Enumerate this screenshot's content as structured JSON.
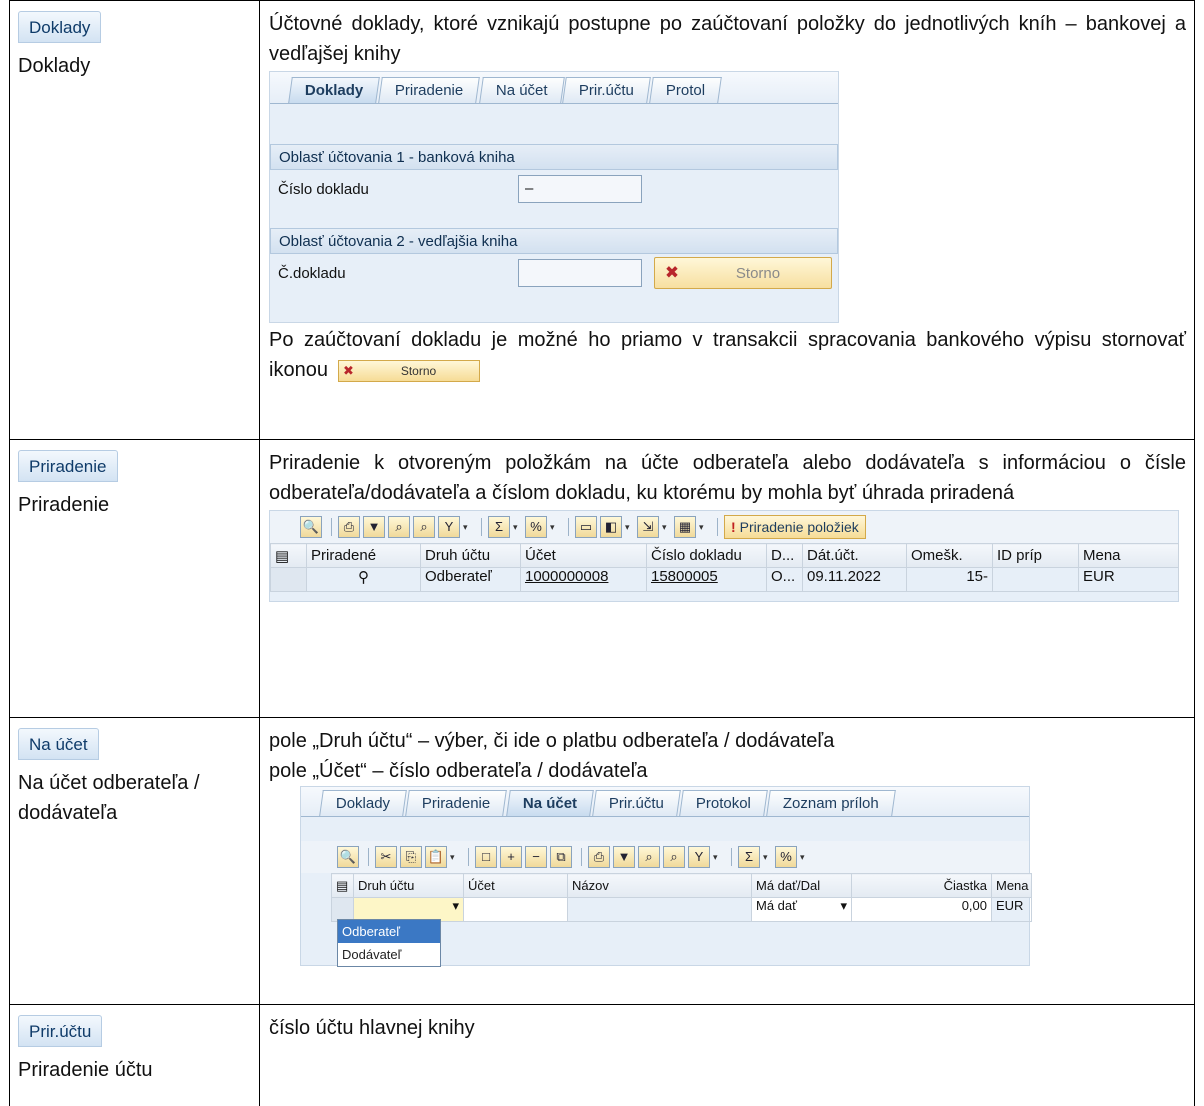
{
  "row1": {
    "chip": "Doklady",
    "caption": "Doklady",
    "desc": "Účtovné doklady, ktoré vznikajú postupne po zaúčtovaní položky do jednotlivých kníh – bankovej a vedľajšej knihy",
    "tabs": [
      "Doklady",
      "Priradenie",
      "Na účet",
      "Prir.účtu",
      "Protol"
    ],
    "group1": "Oblasť účtovania 1 - banková kniha",
    "label1": "Číslo dokladu",
    "value1": "–",
    "group2": "Oblasť účtovania 2 - vedľajšia kniha",
    "label2": "Č.dokladu",
    "storno": "Storno",
    "note": "Po zaúčtovaní dokladu je možné ho priamo v transakcii spracovania bankového výpisu stornovať ikonou"
  },
  "row2": {
    "chip": "Priradenie",
    "caption": "Priradenie",
    "desc": "Priradenie k otvoreným položkám na účte odberateľa alebo dodávateľa s informáciou o čísle odberateľa/dodávateľa a číslom dokladu, ku ktorému by mohla byť úhrada priradená",
    "prir_button": "Priradenie položiek",
    "headers": [
      "Priradené",
      "Druh účtu",
      "Účet",
      "Číslo dokladu",
      "D...",
      "Dát.účt.",
      "Omešk.",
      "ID príp",
      "Mena"
    ],
    "row": [
      "Odberateľ",
      "1000000008",
      "15800005",
      "O...",
      "09.11.2022",
      "15-",
      "",
      "EUR"
    ]
  },
  "row3": {
    "chip": "Na účet",
    "caption": "Na účet odberateľa / dodávateľa",
    "line1": "pole „Druh účtu“ – výber, či ide o platbu odberateľa / dodávateľa",
    "line2": "pole „Účet“ – číslo odberateľa / dodávateľa",
    "tabs": [
      "Doklady",
      "Priradenie",
      "Na účet",
      "Prir.účtu",
      "Protokol",
      "Zoznam príloh"
    ],
    "headers": [
      "Druh účtu",
      "Účet",
      "Názov",
      "Má dať/Dal",
      "Čiastka",
      "Mena"
    ],
    "madat": "Má dať",
    "amount": "0,00",
    "currency": "EUR",
    "options": [
      "Odberateľ",
      "Dodávateľ"
    ]
  },
  "row4": {
    "chip": "Prir.účtu",
    "caption": "Priradenie účtu",
    "desc": "číslo účtu hlavnej knihy"
  }
}
